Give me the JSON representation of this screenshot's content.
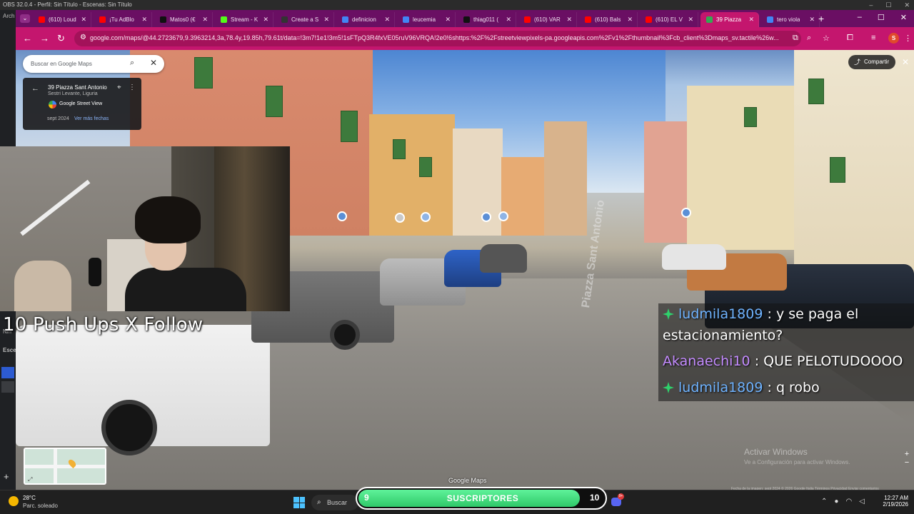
{
  "obs": {
    "title": "OBS 32.0.4 - Perfil: Sin Título - Escenas: Sin Título",
    "left_text_1": "Arch",
    "left_text_2": "Nin",
    "left_text_3": "Esce"
  },
  "browser": {
    "tabs": [
      {
        "label": "(610) Loud",
        "color": "#ff0000"
      },
      {
        "label": "¡Tu AdBlo",
        "color": "#ff0000"
      },
      {
        "label": "Matos0 (€",
        "color": "#111111"
      },
      {
        "label": "Stream - K",
        "color": "#53fc18"
      },
      {
        "label": "Create a S",
        "color": "#333333"
      },
      {
        "label": "definicion",
        "color": "#4285f4"
      },
      {
        "label": "leucemia",
        "color": "#4285f4"
      },
      {
        "label": "thiag011 (",
        "color": "#111111"
      },
      {
        "label": "(610) VAR",
        "color": "#ff0000"
      },
      {
        "label": "(610) Bals",
        "color": "#ff0000"
      },
      {
        "label": "(610) EL V",
        "color": "#ff0000"
      },
      {
        "label": "39 Piazza",
        "color": "#34a853"
      },
      {
        "label": "tero viola",
        "color": "#4285f4"
      }
    ],
    "active_tab_index": 11,
    "url": "google.com/maps/@44.2723679,9.3963214,3a,78.4y,19.85h,79.61t/data=!3m7!1e1!3m5!1sFTpQ3R4fxVE05ruV96VRQA!2e0!6shttps:%2F%2Fstreetviewpixels-pa.googleapis.com%2Fv1%2Fthumbnail%3Fcb_client%3Dmaps_sv.tactile%26w...",
    "profile_initial": "S"
  },
  "maps": {
    "search_placeholder": "Buscar en Google Maps",
    "place_title": "39 Piazza Sant Antonio",
    "place_locality": "Sestri Levante, Liguria",
    "street_view_label": "Google Street View",
    "date": "sept 2024",
    "see_more_dates": "Ver más fechas",
    "share_label": "Compartir",
    "footer_brand": "Google Maps",
    "road_marking": "Piazza Sant Antonio",
    "watermark_title": "Activar Windows",
    "watermark_sub": "Ve a Configuración para activar Windows.",
    "footer_small": "Fecha de la imagen: sept 2024   © 2026 Google   Italia   Términos   Privacidad   Enviar comentarios"
  },
  "overlay": {
    "pushups_text": "10 Push Ups X Follow"
  },
  "chat": {
    "messages": [
      {
        "user": "ludmila1809",
        "text": ": y se paga el",
        "user_color": "#6fb3ff",
        "badge": true
      },
      {
        "user": "",
        "text": "estacionamiento?",
        "user_color": "#ffffff",
        "badge": false
      },
      {
        "user": "Akanaechi10",
        "text": ": QUE PELOTUDOOOO",
        "user_color": "#c48cff",
        "badge": false
      },
      {
        "user": "ludmila1809",
        "text": ": q robo",
        "user_color": "#6fb3ff",
        "badge": true
      }
    ]
  },
  "taskbar": {
    "temperature": "28°C",
    "condition": "Parc. soleado",
    "search_label": "Buscar",
    "subgoal": {
      "label": "SUSCRIPTORES",
      "current": "9",
      "goal": "10",
      "progress_fraction": 0.9
    },
    "discord_badge": "9+",
    "time": "12:27 AM",
    "date": "2/19/2026"
  }
}
